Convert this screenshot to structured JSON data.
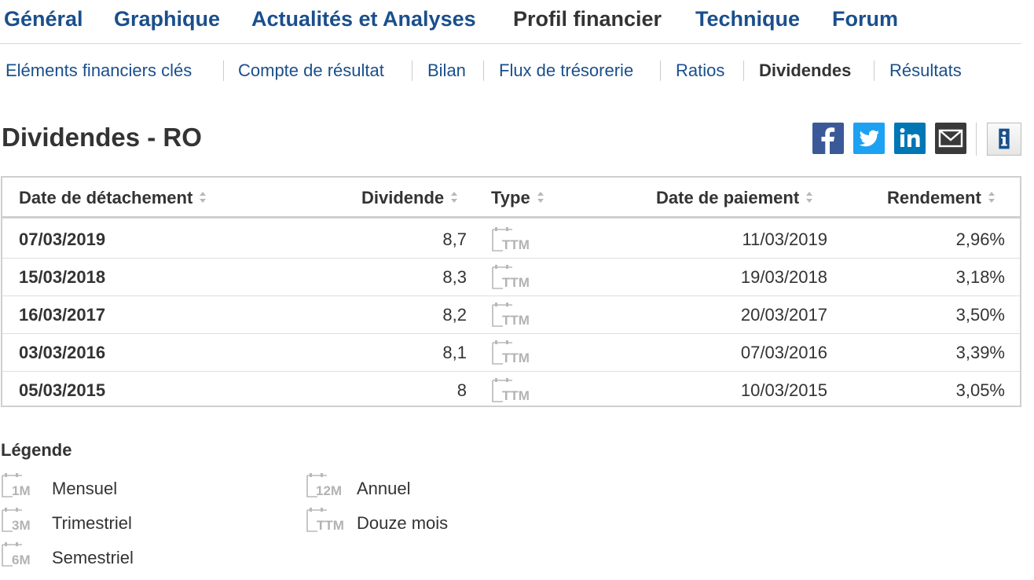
{
  "top_nav": {
    "tabs": [
      {
        "label": "Général",
        "active": false
      },
      {
        "label": "Graphique",
        "active": false
      },
      {
        "label": "Actualités et Analyses",
        "active": false
      },
      {
        "label": "Profil financier",
        "active": true
      },
      {
        "label": "Technique",
        "active": false
      },
      {
        "label": "Forum",
        "active": false
      }
    ]
  },
  "sub_nav": {
    "items": [
      {
        "label": "Eléments financiers clés",
        "active": false
      },
      {
        "label": "Compte de résultat",
        "active": false
      },
      {
        "label": "Bilan",
        "active": false
      },
      {
        "label": "Flux de trésorerie",
        "active": false
      },
      {
        "label": "Ratios",
        "active": false
      },
      {
        "label": "Dividendes",
        "active": true
      },
      {
        "label": "Résultats",
        "active": false
      }
    ]
  },
  "page": {
    "title": "Dividendes - RO"
  },
  "share": {
    "icons": [
      "facebook-icon",
      "twitter-icon",
      "linkedin-icon",
      "email-icon",
      "info-icon"
    ],
    "colors": {
      "facebook": "#3b5998",
      "twitter": "#1da1f2",
      "linkedin": "#0077b5",
      "email": "#3a3a3a"
    }
  },
  "table": {
    "headers": {
      "date_detachement": "Date de détachement",
      "dividende": "Dividende",
      "type": "Type",
      "date_paiement": "Date de paiement",
      "rendement": "Rendement"
    },
    "rows": [
      {
        "date_detachement": "07/03/2019",
        "dividende": "8,7",
        "type": "TTM",
        "date_paiement": "11/03/2019",
        "rendement": "2,96%"
      },
      {
        "date_detachement": "15/03/2018",
        "dividende": "8,3",
        "type": "TTM",
        "date_paiement": "19/03/2018",
        "rendement": "3,18%"
      },
      {
        "date_detachement": "16/03/2017",
        "dividende": "8,2",
        "type": "TTM",
        "date_paiement": "20/03/2017",
        "rendement": "3,50%"
      },
      {
        "date_detachement": "03/03/2016",
        "dividende": "8,1",
        "type": "TTM",
        "date_paiement": "07/03/2016",
        "rendement": "3,39%"
      },
      {
        "date_detachement": "05/03/2015",
        "dividende": "8",
        "type": "TTM",
        "date_paiement": "10/03/2015",
        "rendement": "3,05%"
      }
    ]
  },
  "legend": {
    "title": "Légende",
    "items": [
      {
        "code": "1M",
        "label": "Mensuel"
      },
      {
        "code": "3M",
        "label": "Trimestriel"
      },
      {
        "code": "6M",
        "label": "Semestriel"
      },
      {
        "code": "12M",
        "label": "Annuel"
      },
      {
        "code": "TTM",
        "label": "Douze mois"
      }
    ]
  },
  "colors": {
    "link": "#1a4f8c",
    "text": "#333333",
    "border": "#cfcfcf",
    "icon_gray": "#b3b3b3"
  }
}
